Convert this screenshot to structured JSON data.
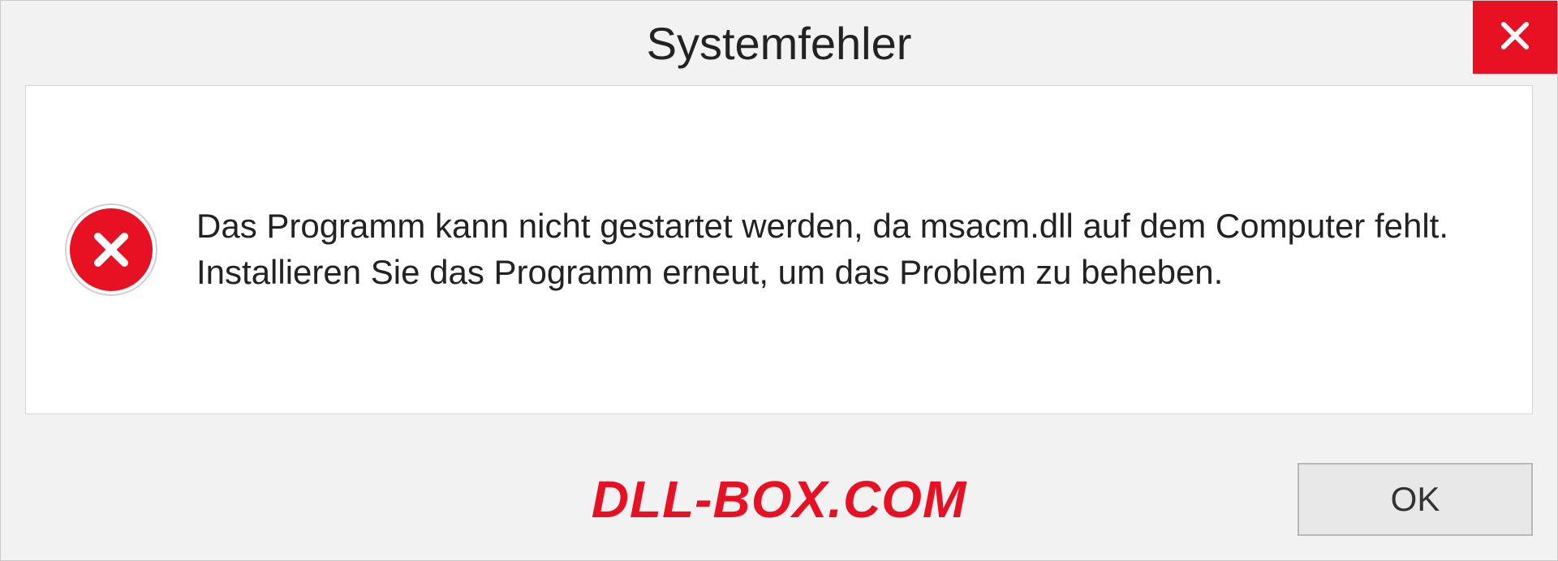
{
  "dialog": {
    "title": "Systemfehler",
    "message": "Das Programm kann nicht gestartet werden, da msacm.dll auf dem Computer fehlt. Installieren Sie das Programm erneut, um das Problem zu beheben.",
    "ok_label": "OK",
    "watermark": "DLL-BOX.COM"
  },
  "colors": {
    "error_red": "#e81123",
    "background": "#f2f2f2",
    "panel_white": "#ffffff"
  }
}
